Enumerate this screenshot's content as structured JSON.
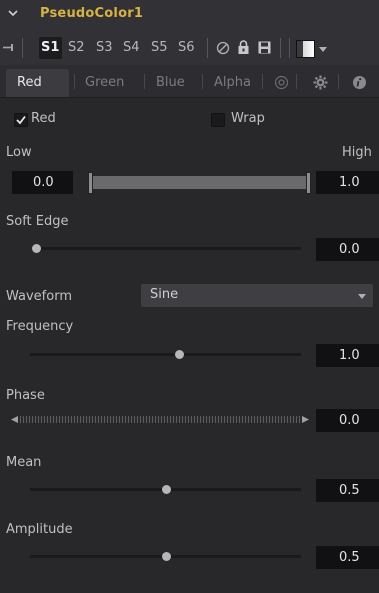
{
  "header": {
    "title": "PseudoColor1"
  },
  "toolbar": {
    "slots": [
      "S1",
      "S2",
      "S3",
      "S4",
      "S5",
      "S6"
    ]
  },
  "tabs": [
    "Red",
    "Green",
    "Blue",
    "Alpha"
  ],
  "colors": {
    "title": "#d6b340",
    "background": "#28282b",
    "value_box": "#111113"
  },
  "controls": {
    "red_checkbox": {
      "label": "Red",
      "checked": true
    },
    "wrap_checkbox": {
      "label": "Wrap",
      "checked": false
    },
    "low_label": "Low",
    "high_label": "High",
    "low_value": "0.0",
    "high_value": "1.0",
    "soft_edge": {
      "label": "Soft Edge",
      "value": "0.0",
      "fraction": 0.0
    },
    "waveform": {
      "label": "Waveform",
      "selected": "Sine"
    },
    "frequency": {
      "label": "Frequency",
      "value": "1.0",
      "fraction": 0.55
    },
    "phase": {
      "label": "Phase",
      "value": "0.0"
    },
    "mean": {
      "label": "Mean",
      "value": "0.5",
      "fraction": 0.5
    },
    "amplitude": {
      "label": "Amplitude",
      "value": "0.5",
      "fraction": 0.5
    }
  }
}
